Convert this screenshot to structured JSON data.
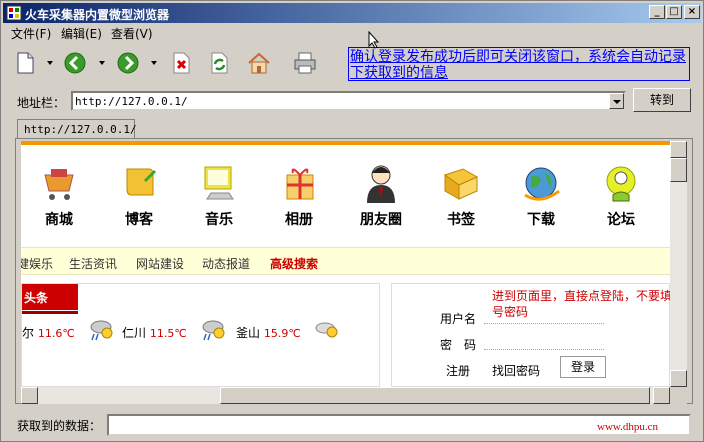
{
  "window": {
    "title": "火车采集器内置微型浏览器"
  },
  "menu": {
    "items": [
      "文件(F)",
      "编辑(E)",
      "查看(V)"
    ]
  },
  "toolbar": {
    "notice": "确认登录发布成功后即可关闭该窗口，系统会自动记录下获取到的信息"
  },
  "address": {
    "label": "地址栏：",
    "value": "http://127.0.0.1/",
    "go_label": "转到"
  },
  "tab": {
    "label": "http://127.0.0.1/"
  },
  "page": {
    "nav": [
      {
        "label": "商城",
        "icon": "shopping-cart-icon"
      },
      {
        "label": "博客",
        "icon": "scroll-icon"
      },
      {
        "label": "音乐",
        "icon": "monitor-icon"
      },
      {
        "label": "相册",
        "icon": "gift-icon"
      },
      {
        "label": "朋友圈",
        "icon": "person-icon"
      },
      {
        "label": "书签",
        "icon": "book-icon"
      },
      {
        "label": "下载",
        "icon": "globe-icon"
      },
      {
        "label": "论坛",
        "icon": "chat-icon"
      }
    ],
    "subnav": [
      "健娱乐",
      "生活资讯",
      "网站建设",
      "动态报道",
      "高级搜索"
    ],
    "news_tab": "头条",
    "weather": [
      {
        "city": "尔",
        "temp": "11.6℃"
      },
      {
        "city": "仁川",
        "temp": "11.5℃"
      },
      {
        "city": "釜山",
        "temp": "15.9℃"
      }
    ],
    "login": {
      "note": "进到页面里，直接点登陆，不要填账号密码",
      "username_label": "用户名",
      "password_label": "密　码",
      "register": "注册",
      "recover": "找回密码",
      "submit": "登录"
    }
  },
  "bottom": {
    "data_label": "获取到的数据：",
    "watermark": "www.dhpu.cn"
  }
}
